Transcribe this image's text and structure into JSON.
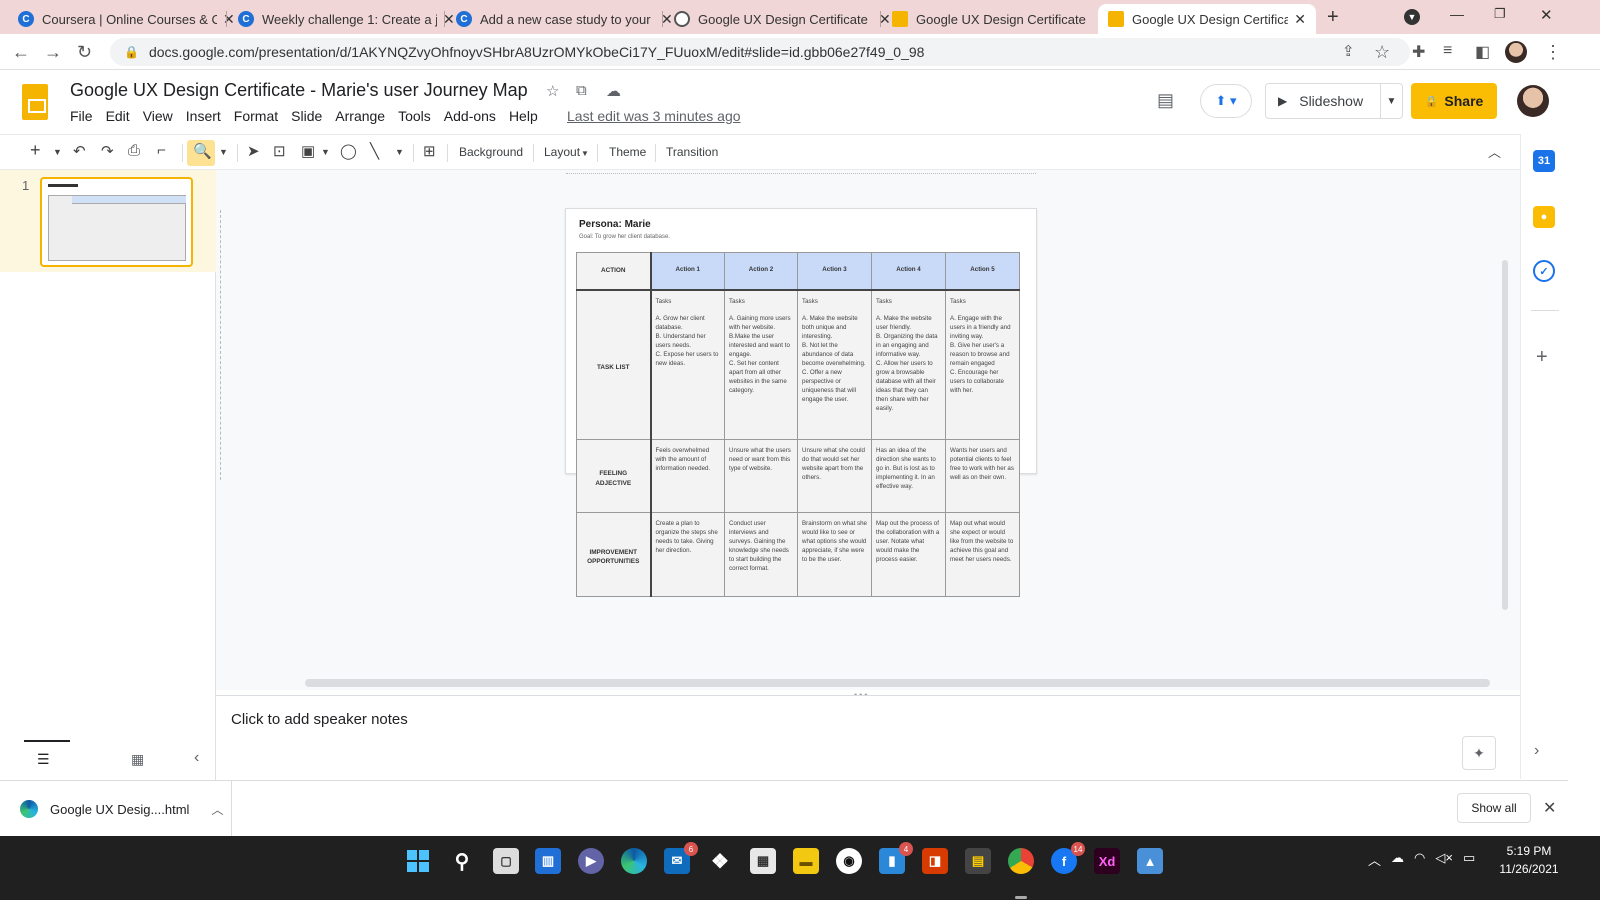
{
  "browser": {
    "tabs": [
      {
        "title": "Coursera | Online Courses & C",
        "icon": "coursera-icon"
      },
      {
        "title": "Weekly challenge 1: Create a j",
        "icon": "coursera-icon"
      },
      {
        "title": "Add a new case study to your",
        "icon": "coursera-icon"
      },
      {
        "title": "Google UX Design Certificate",
        "icon": "globe-icon"
      },
      {
        "title": "Google UX Design Certificate",
        "icon": "slides-icon"
      },
      {
        "title": "Google UX Design Certificate",
        "icon": "slides-icon",
        "active": true
      }
    ],
    "url": "docs.google.com/presentation/d/1AKYNQZvyOhfnoyvSHbrA8UzrOMYkObeCi17Y_FUuoxM/edit#slide=id.gbb06e27f49_0_98"
  },
  "doc": {
    "title": "Google UX Design Certificate - Marie's user Journey Map",
    "menu": [
      "File",
      "Edit",
      "View",
      "Insert",
      "Format",
      "Slide",
      "Arrange",
      "Tools",
      "Add-ons",
      "Help"
    ],
    "last_edit": "Last edit was 3 minutes ago",
    "slideshow_label": "Slideshow",
    "share_label": "Share"
  },
  "toolbar": {
    "background": "Background",
    "layout": "Layout",
    "theme": "Theme",
    "transition": "Transition"
  },
  "filmstrip": {
    "slide_number": "1"
  },
  "slide": {
    "persona_title": "Persona: Marie",
    "goal": "Goal: To grow her client database.",
    "table": {
      "corner": "ACTION",
      "columns": [
        "Action 1",
        "Action 2",
        "Action 3",
        "Action 4",
        "Action 5"
      ],
      "rows": [
        {
          "label": "TASK LIST",
          "cells": [
            "Tasks\n\nA. Grow her client database.\nB. Understand her users needs.\nC. Expose her users to new ideas.",
            "Tasks\n\nA. Gaining more users with her website.\nB.Make the user interested and want to engage.\nC. Set her content apart from all other websites in the same category.",
            "Tasks\n\nA. Make the website both unique and interesting.\nB. Not let the abundance of data become overwhelming.\nC. Offer a new perspective or uniqueness that will engage the user.",
            "Tasks\n\nA. Make the website user friendly.\nB. Organizing the data in an engaging and informative way.\nC. Allow her users to grow a browsable database with all their ideas that they can then share with her easily.",
            "Tasks\n\nA. Engage with the users in a friendly and inviting way.\nB. Give her user's a reason to browse and remain engaged\nC. Encourage her users to collaborate with her."
          ]
        },
        {
          "label": "FEELING ADJECTIVE",
          "cells": [
            "Feels overwhelmed with the amount of information needed.",
            "Unsure what the users need or want from this type of website.",
            "Unsure what she could do that would set her website apart from the others.",
            "Has an idea of the direction she wants to go in. But is lost as to implementing it. In an effective way.",
            "Wants her users and potential clients to feel free to work with her as well as on their own."
          ]
        },
        {
          "label": "IMPROVEMENT OPPORTUNITIES",
          "cells": [
            "Create a plan to organize the steps she needs to take. Giving her direction.",
            "Conduct user interviews and surveys. Gaining the knowledge she needs to start building the correct format.",
            "Brainstorm on what she would like to see or what options she would appreciate, if she were to be the user.",
            "Map out the process of the collaboration with a user. Notate what would make the process easier.",
            "Map out what would she expect or would like from the website to achieve this goal and meet her users needs."
          ]
        }
      ]
    }
  },
  "notes": {
    "placeholder": "Click to add speaker notes"
  },
  "downloads": {
    "file": "Google UX Desig....html",
    "show_all": "Show all"
  },
  "taskbar": {
    "badges": {
      "mail": "6",
      "teams": "4",
      "facebook": "14"
    },
    "xd_label": "Xd",
    "time": "5:19 PM",
    "date": "11/26/2021"
  },
  "colors": {
    "accent": "#fbbc04",
    "header_blue": "#c9daf8",
    "tab_strip": "#f0d6d6"
  }
}
